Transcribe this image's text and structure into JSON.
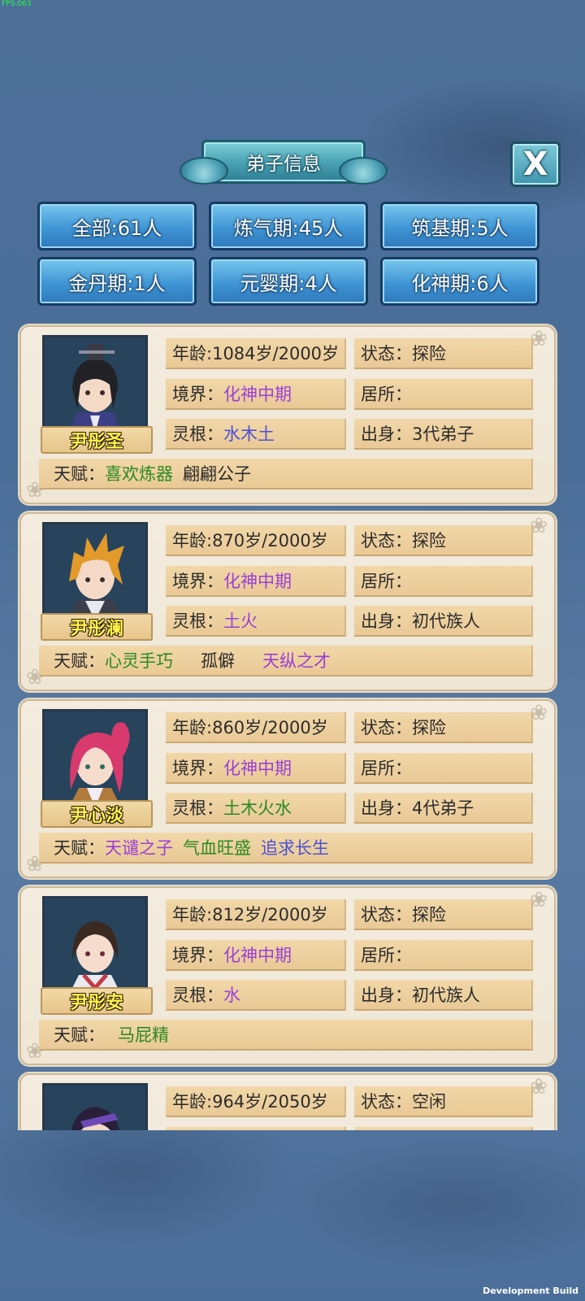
{
  "debug": {
    "fps": "FPS:063",
    "build": "Development Build"
  },
  "title": "弟子信息",
  "close_label": "X",
  "filters": [
    {
      "label": "全部:61人"
    },
    {
      "label": "炼气期:45人"
    },
    {
      "label": "筑基期:5人"
    },
    {
      "label": "金丹期:1人"
    },
    {
      "label": "元婴期:4人"
    },
    {
      "label": "化神期:6人"
    }
  ],
  "disciples": [
    {
      "name": "尹彤圣",
      "age_label": "年龄:",
      "age": "1084岁/2000岁",
      "state_label": "状态：",
      "state": "探险",
      "realm_label": "境界：",
      "realm": "化神中期",
      "home_label": "居所：",
      "home": "",
      "root_label": "灵根：",
      "root": "水木土",
      "origin_label": "出身：",
      "origin": "3代弟子",
      "talent_label": "天赋：",
      "talents": [
        {
          "text": "喜欢炼器",
          "color": "green"
        },
        {
          "text": "翩翩公子",
          "color": "dark"
        }
      ]
    },
    {
      "name": "尹彤澜",
      "age_label": "年龄:",
      "age": "870岁/2000岁",
      "state_label": "状态：",
      "state": "探险",
      "realm_label": "境界：",
      "realm": "化神中期",
      "home_label": "居所：",
      "home": "",
      "root_label": "灵根：",
      "root": "土火",
      "origin_label": "出身：",
      "origin": "初代族人",
      "talent_label": "天赋：",
      "talents": [
        {
          "text": "心灵手巧",
          "color": "green"
        },
        {
          "text": "孤僻",
          "color": "dark"
        },
        {
          "text": "天纵之才",
          "color": "purple"
        }
      ]
    },
    {
      "name": "尹心淡",
      "age_label": "年龄:",
      "age": "860岁/2000岁",
      "state_label": "状态：",
      "state": "探险",
      "realm_label": "境界：",
      "realm": "化神中期",
      "home_label": "居所：",
      "home": "",
      "root_label": "灵根：",
      "root": "土木火水",
      "origin_label": "出身：",
      "origin": "4代弟子",
      "talent_label": "天赋：",
      "talents": [
        {
          "text": "天谴之子",
          "color": "purple"
        },
        {
          "text": "气血旺盛",
          "color": "green"
        },
        {
          "text": "追求长生",
          "color": "blue"
        }
      ]
    },
    {
      "name": "尹彤安",
      "age_label": "年龄:",
      "age": "812岁/2000岁",
      "state_label": "状态：",
      "state": "探险",
      "realm_label": "境界：",
      "realm": "化神中期",
      "home_label": "居所：",
      "home": "",
      "root_label": "灵根：",
      "root": "水",
      "origin_label": "出身：",
      "origin": "初代族人",
      "talent_label": "天赋：",
      "talents": [
        {
          "text": "马屁精",
          "color": "green"
        }
      ]
    },
    {
      "name": "",
      "age_label": "年龄:",
      "age": "964岁/2050岁",
      "state_label": "状态：",
      "state": "空闲",
      "realm_label": "",
      "realm": "",
      "home_label": "",
      "home": "",
      "root_label": "",
      "root": "",
      "origin_label": "",
      "origin": "",
      "talent_label": "",
      "talents": []
    }
  ],
  "colors": {
    "realm": "#9a3fd6",
    "root_blue": "#4a52d8",
    "green": "#2a8a22",
    "name_yellow": "#fff24a",
    "background": "#4d6f98"
  }
}
